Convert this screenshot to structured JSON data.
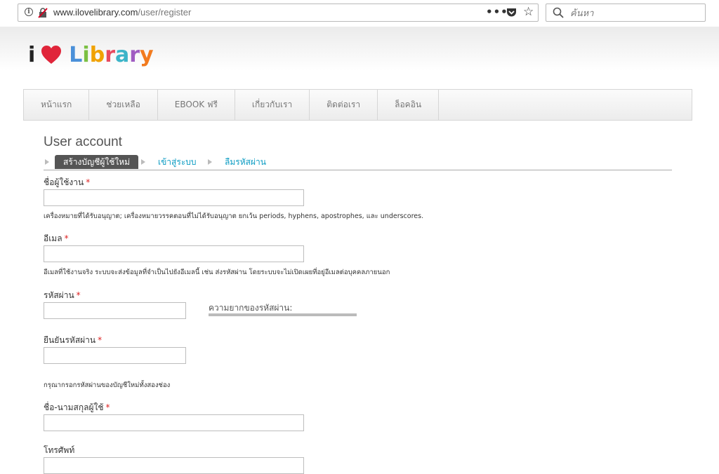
{
  "browser": {
    "url_domain": "www.ilovelibrary.com",
    "url_path": "/user/register",
    "more_label": "•••",
    "star_label": "☆",
    "search_placeholder": "ค้นหา"
  },
  "logo": {
    "first": "i",
    "word": "Library",
    "letters": [
      {
        "char": "L",
        "color": "#4a90d9"
      },
      {
        "char": "i",
        "color": "#7bc043"
      },
      {
        "char": "b",
        "color": "#f0a202"
      },
      {
        "char": "r",
        "color": "#e84a5f"
      },
      {
        "char": "a",
        "color": "#3cb4c8"
      },
      {
        "char": "r",
        "color": "#a05cc2"
      },
      {
        "char": "y",
        "color": "#f27b1f"
      }
    ],
    "heart_color": "#e0253a"
  },
  "nav": {
    "items": [
      {
        "label": "หน้าแรก"
      },
      {
        "label": "ช่วยเหลือ"
      },
      {
        "label": "EBOOK ฟรี"
      },
      {
        "label": "เกี่ยวกับเรา"
      },
      {
        "label": "ติดต่อเรา"
      },
      {
        "label": "ล็อคอิน"
      }
    ]
  },
  "page": {
    "title": "User account",
    "tabs": [
      {
        "label": "สร้างบัญชีผู้ใช้ใหม่",
        "active": true
      },
      {
        "label": "เข้าสู่ระบบ",
        "active": false
      },
      {
        "label": "ลืมรหัสผ่าน",
        "active": false
      }
    ]
  },
  "form": {
    "required_mark": "*",
    "username": {
      "label": "ชื่อผู้ใช้งาน",
      "value": "",
      "help": "เครื่องหมายที่ได้รับอนุญาต; เครื่องหมายวรรคตอนที่ไม่ได้รับอนุญาต ยกเว้น periods, hyphens, apostrophes, และ underscores."
    },
    "email": {
      "label": "อีเมล",
      "value": "",
      "help": "อีเมลที่ใช้งานจริง ระบบจะส่งข้อมูลที่จำเป็นไปยังอีเมลนี้ เช่น ส่งรหัสผ่าน โดยระบบจะไม่เปิดเผยที่อยู่อีเมลต่อบุคคลภายนอก"
    },
    "password": {
      "label": "รหัสผ่าน",
      "value": "",
      "strength_label": "ความยากของรหัสผ่าน:",
      "strength": 0
    },
    "confirm_password": {
      "label": "ยืนยันรหัสผ่าน",
      "value": "",
      "help": "กรุณากรอกรหัสผ่านของบัญชีใหม่ทั้งสองช่อง"
    },
    "fullname": {
      "label": "ชื่อ-นามสกุลผู้ใช้",
      "value": ""
    },
    "phone": {
      "label": "โทรศัพท์",
      "value": ""
    }
  }
}
